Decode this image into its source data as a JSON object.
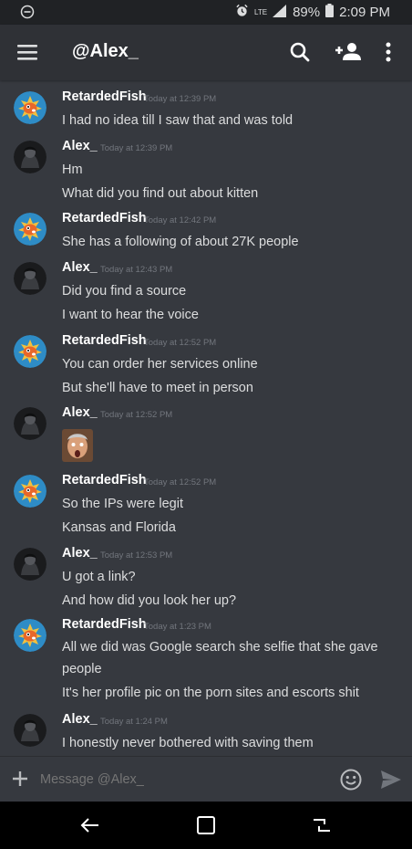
{
  "status_bar": {
    "lte": "LTE",
    "battery": "89%",
    "time": "2:09 PM"
  },
  "header": {
    "title": "@Alex_"
  },
  "messages": [
    {
      "author": "RetardedFish",
      "timestamp": "Today at 12:39 PM",
      "lines": [
        "I had no idea till I saw that and was told"
      ]
    },
    {
      "author": "Alex_",
      "timestamp": "Today at 12:39 PM",
      "lines": [
        "Hm",
        "What did you find out about kitten"
      ]
    },
    {
      "author": "RetardedFish",
      "timestamp": "Today at 12:42 PM",
      "lines": [
        "She has a following of about 27K people"
      ]
    },
    {
      "author": "Alex_",
      "timestamp": "Today at 12:43 PM",
      "lines": [
        "Did you find a source",
        "I want to hear the voice"
      ]
    },
    {
      "author": "RetardedFish",
      "timestamp": "Today at 12:52 PM",
      "lines": [
        "You can order her services online",
        "But she'll have to meet in person"
      ]
    },
    {
      "author": "Alex_",
      "timestamp": "Today at 12:52 PM",
      "emoji": "surprised-face-emoji"
    },
    {
      "author": "RetardedFish",
      "timestamp": "Today at 12:52 PM",
      "lines": [
        "So the IPs were legit",
        "Kansas and Florida"
      ]
    },
    {
      "author": "Alex_",
      "timestamp": "Today at 12:53 PM",
      "lines": [
        "U got a link?",
        "And how did you look her up?"
      ]
    },
    {
      "author": "RetardedFish",
      "timestamp": "Today at 1:23 PM",
      "lines": [
        "All we did was Google search she selfie that she gave people",
        "It's her profile pic on the porn sites and escorts shit"
      ]
    },
    {
      "author": "Alex_",
      "timestamp": "Today at 1:24 PM",
      "lines": [
        "I honestly never bothered with saving them"
      ]
    }
  ],
  "composer": {
    "placeholder": "Message @Alex_"
  },
  "colors": {
    "background": "#36393f",
    "header": "#2f3136",
    "text": "#dcddde",
    "muted": "#72767d",
    "fish_avatar_bg": "#2e8cc6",
    "fish_accent": "#e8672a"
  }
}
